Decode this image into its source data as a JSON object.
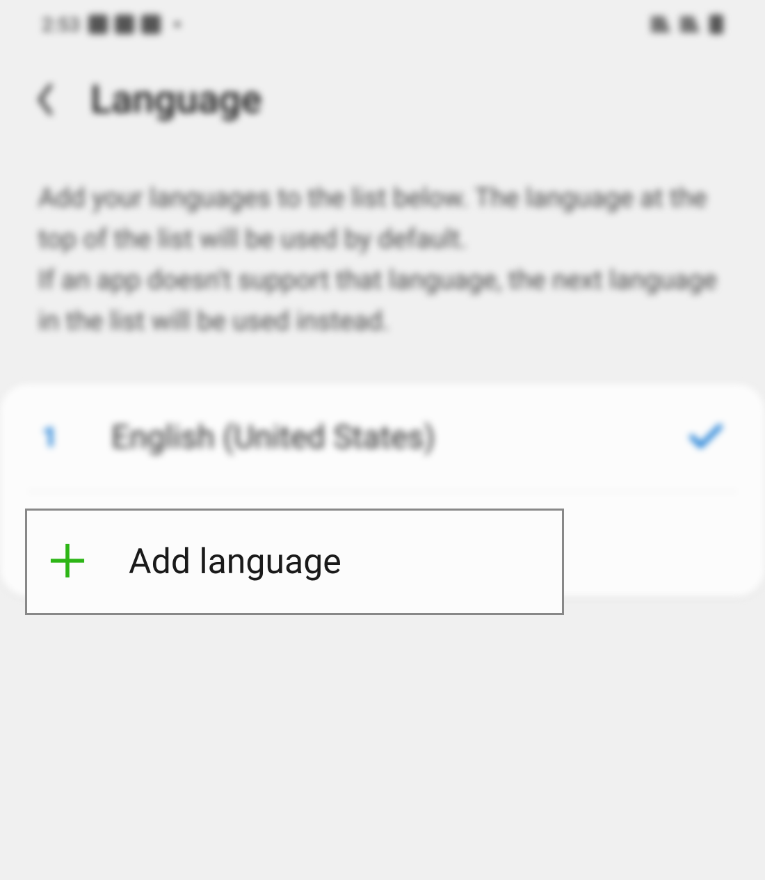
{
  "status": {
    "time": "2:53"
  },
  "header": {
    "title": "Language"
  },
  "description": {
    "line1": "Add your languages to the list below. The language at the top of the list will be used by default.",
    "line2": "If an app doesn't support that language, the next language in the list will be used instead."
  },
  "languages": [
    {
      "order": "1",
      "name": "English (United States)",
      "selected": true
    }
  ],
  "actions": {
    "add_label": "Add language"
  }
}
